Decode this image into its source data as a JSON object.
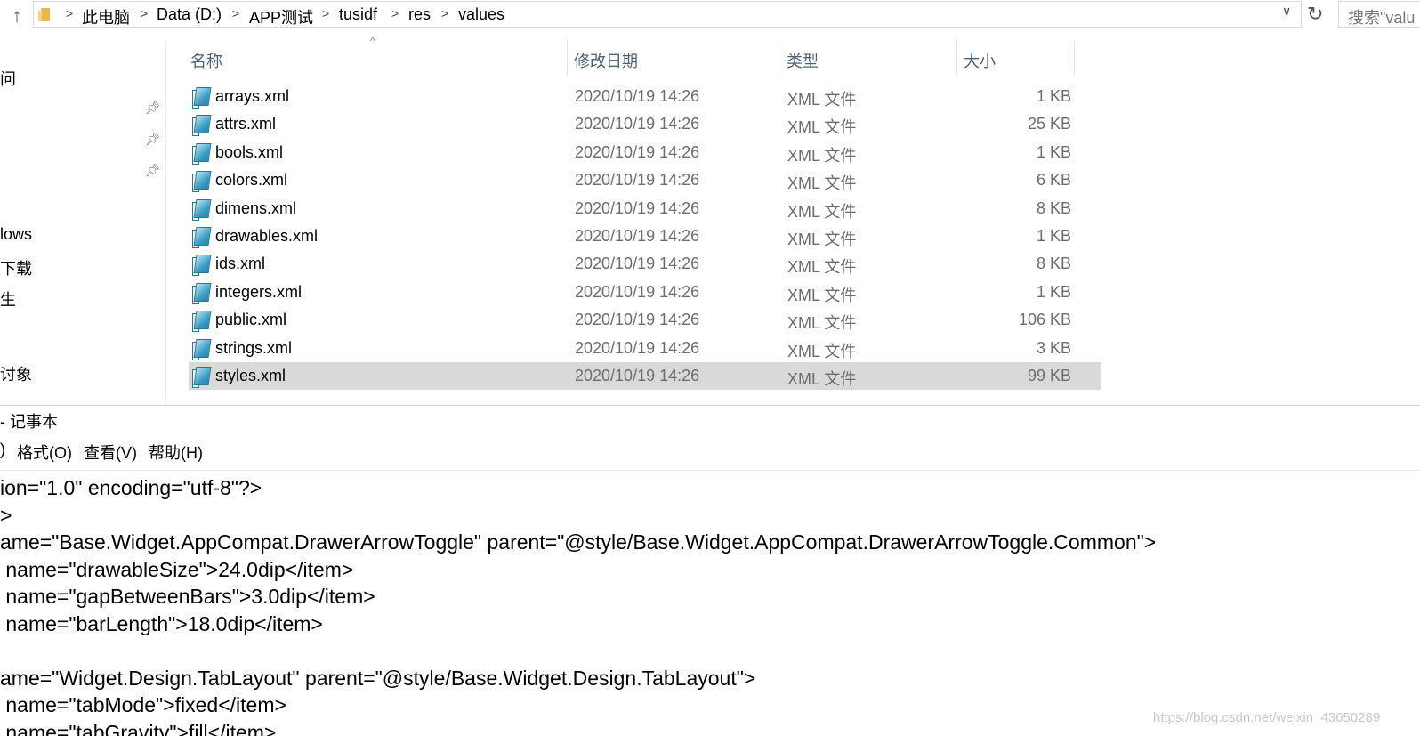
{
  "explorer": {
    "breadcrumbs": [
      "此电脑",
      "Data (D:)",
      "APP测试",
      "tusidf",
      "res",
      "values"
    ],
    "search_placeholder": "搜索\"valu",
    "nav_items": [
      "问",
      "lows",
      "下载",
      "生",
      "讨象"
    ],
    "columns": {
      "name": "名称",
      "date": "修改日期",
      "type": "类型",
      "size": "大小"
    },
    "files": [
      {
        "name": "arrays.xml",
        "date": "2020/10/19 14:26",
        "type": "XML 文件",
        "size": "1 KB"
      },
      {
        "name": "attrs.xml",
        "date": "2020/10/19 14:26",
        "type": "XML 文件",
        "size": "25 KB"
      },
      {
        "name": "bools.xml",
        "date": "2020/10/19 14:26",
        "type": "XML 文件",
        "size": "1 KB"
      },
      {
        "name": "colors.xml",
        "date": "2020/10/19 14:26",
        "type": "XML 文件",
        "size": "6 KB"
      },
      {
        "name": "dimens.xml",
        "date": "2020/10/19 14:26",
        "type": "XML 文件",
        "size": "8 KB"
      },
      {
        "name": "drawables.xml",
        "date": "2020/10/19 14:26",
        "type": "XML 文件",
        "size": "1 KB"
      },
      {
        "name": "ids.xml",
        "date": "2020/10/19 14:26",
        "type": "XML 文件",
        "size": "8 KB"
      },
      {
        "name": "integers.xml",
        "date": "2020/10/19 14:26",
        "type": "XML 文件",
        "size": "1 KB"
      },
      {
        "name": "public.xml",
        "date": "2020/10/19 14:26",
        "type": "XML 文件",
        "size": "106 KB"
      },
      {
        "name": "strings.xml",
        "date": "2020/10/19 14:26",
        "type": "XML 文件",
        "size": "3 KB"
      },
      {
        "name": "styles.xml",
        "date": "2020/10/19 14:26",
        "type": "XML 文件",
        "size": "99 KB",
        "selected": true
      }
    ]
  },
  "notepad": {
    "title": "- 记事本",
    "menu": [
      ")",
      "格式(O)",
      "查看(V)",
      "帮助(H)"
    ],
    "lines": [
      "ion=\"1.0\" encoding=\"utf-8\"?>",
      ">",
      "ame=\"Base.Widget.AppCompat.DrawerArrowToggle\" parent=\"@style/Base.Widget.AppCompat.DrawerArrowToggle.Common\">",
      " name=\"drawableSize\">24.0dip</item>",
      " name=\"gapBetweenBars\">3.0dip</item>",
      " name=\"barLength\">18.0dip</item>",
      "",
      "ame=\"Widget.Design.TabLayout\" parent=\"@style/Base.Widget.Design.TabLayout\">",
      " name=\"tabMode\">fixed</item>",
      " name=\"tabGravity\">fill</item>"
    ]
  },
  "watermark": "https://blog.csdn.net/weixin_43650289",
  "colors": {
    "selected_row": "#d9d9d9",
    "column_header": "#4c607a",
    "muted_text": "#6d6d6d"
  }
}
